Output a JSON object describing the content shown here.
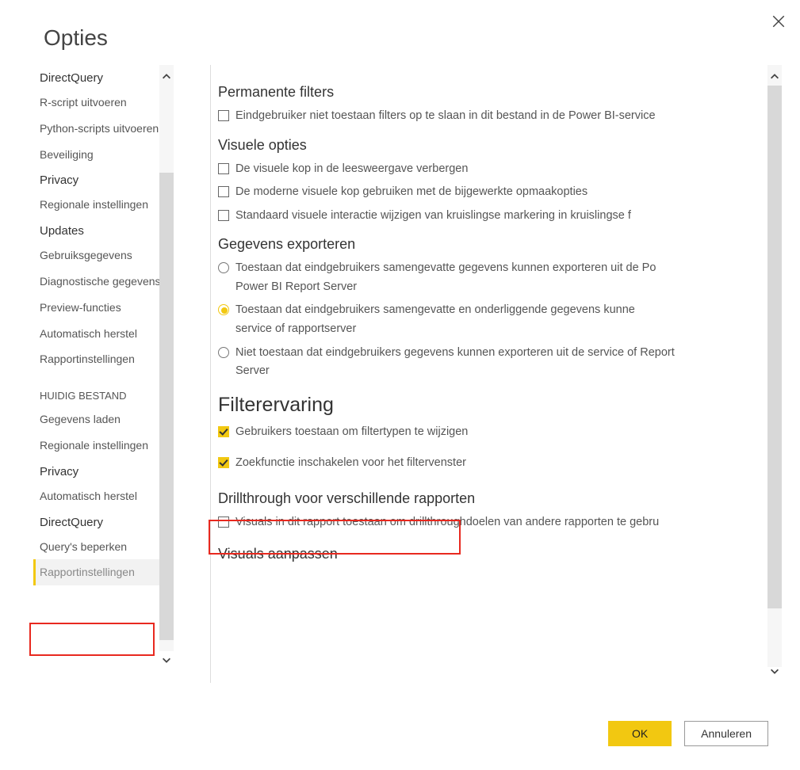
{
  "dialog": {
    "title": "Opties",
    "close_icon": "close-icon"
  },
  "sidebar": {
    "items": [
      {
        "type": "header",
        "label": "DirectQuery"
      },
      {
        "type": "item",
        "label": "R-script uitvoeren"
      },
      {
        "type": "item",
        "label": "Python-scripts uitvoeren"
      },
      {
        "type": "item",
        "label": "Beveiliging"
      },
      {
        "type": "header",
        "label": "Privacy"
      },
      {
        "type": "item",
        "label": "Regionale instellingen"
      },
      {
        "type": "header",
        "label": "Updates"
      },
      {
        "type": "item",
        "label": "Gebruiksgegevens"
      },
      {
        "type": "item",
        "label": "Diagnostische gegevens"
      },
      {
        "type": "item",
        "label": "Preview-functies"
      },
      {
        "type": "item",
        "label": "Automatisch herstel"
      },
      {
        "type": "item",
        "label": "Rapportinstellingen"
      },
      {
        "type": "section",
        "label": "HUIDIG BESTAND"
      },
      {
        "type": "item",
        "label": "Gegevens laden"
      },
      {
        "type": "item",
        "label": "Regionale instellingen"
      },
      {
        "type": "header",
        "label": "Privacy"
      },
      {
        "type": "item",
        "label": "Automatisch herstel"
      },
      {
        "type": "header",
        "label": "DirectQuery"
      },
      {
        "type": "item",
        "label": "Query's beperken"
      },
      {
        "type": "item-selected",
        "label": "Rapportinstellingen"
      }
    ]
  },
  "content": {
    "sections": {
      "permanente_filters": {
        "heading": "Permanente filters",
        "opt1": "Eindgebruiker niet toestaan filters op te slaan in dit bestand in de Power BI-service"
      },
      "visuele_opties": {
        "heading": "Visuele opties",
        "opt1": "De visuele kop in de leesweergave verbergen",
        "opt2": "De moderne visuele kop gebruiken met de bijgewerkte opmaakopties",
        "opt3": "Standaard visuele interactie wijzigen van kruislingse markering in kruislingse f"
      },
      "gegevens_exporteren": {
        "heading": "Gegevens exporteren",
        "opt1_line1": "Toestaan dat eindgebruikers samengevatte gegevens kunnen exporteren uit de Po",
        "opt1_line2": "Power BI Report Server",
        "opt2_line1": "Toestaan dat eindgebruikers samengevatte en onderliggende gegevens kunne",
        "opt2_line2": "service of rapportserver",
        "opt3_line1": "Niet toestaan dat eindgebruikers gegevens kunnen exporteren uit de service of Report",
        "opt3_line2": "Server"
      },
      "filterervaring": {
        "heading": "Filterervaring",
        "opt1": "Gebruikers toestaan om filtertypen te wijzigen",
        "opt2": "Zoekfunctie inschakelen voor het filtervenster"
      },
      "drillthrough": {
        "heading": "Drillthrough voor verschillende rapporten",
        "opt1": "Visuals in dit rapport toestaan om drillthroughdoelen van andere rapporten te gebru"
      },
      "visuals_aanpassen": {
        "heading": "Visuals aanpassen"
      }
    }
  },
  "footer": {
    "ok": "OK",
    "cancel": "Annuleren"
  }
}
